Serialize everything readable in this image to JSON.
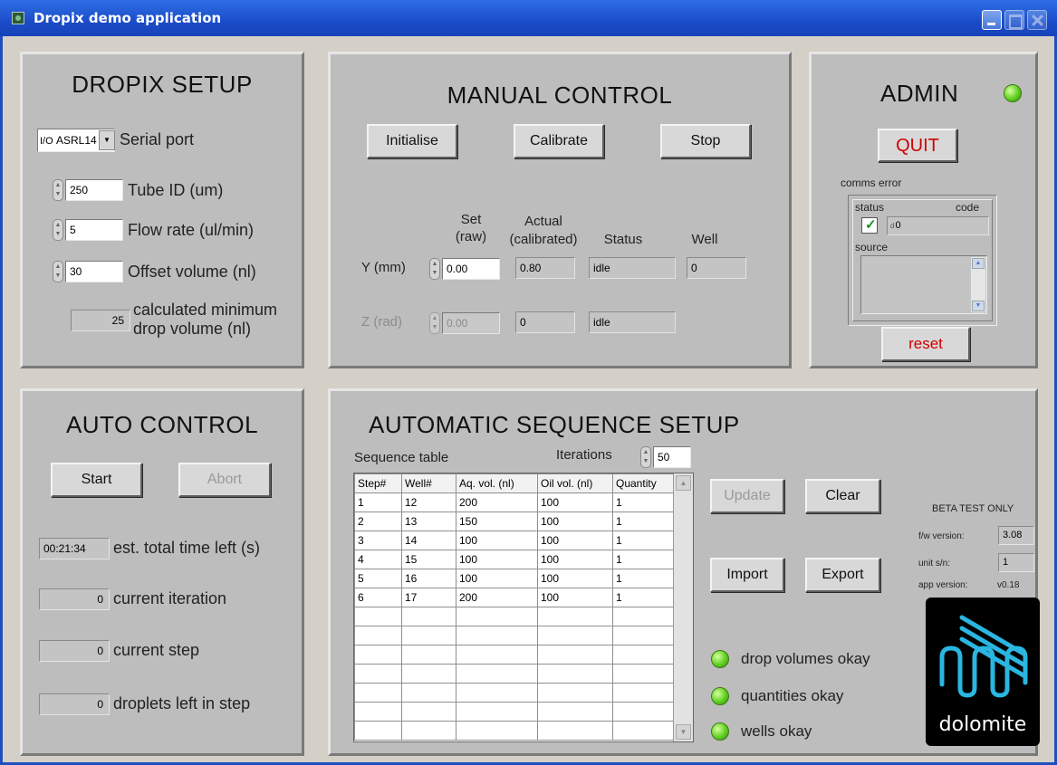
{
  "window": {
    "title": "Dropix demo application"
  },
  "setup": {
    "title": "DROPIX SETUP",
    "serial_value": "ASRL14",
    "serial_label": "Serial port",
    "tube_id_value": "250",
    "tube_id_label": "Tube ID (um)",
    "flow_value": "5",
    "flow_label": "Flow rate (ul/min)",
    "offset_value": "30",
    "offset_label": "Offset volume (nl)",
    "min_drop_value": "25",
    "min_drop_label_1": "calculated minimum",
    "min_drop_label_2": "drop volume (nl)"
  },
  "manual": {
    "title": "MANUAL CONTROL",
    "initialise": "Initialise",
    "calibrate": "Calibrate",
    "stop": "Stop",
    "hdr_set_1": "Set",
    "hdr_set_2": "(raw)",
    "hdr_actual_1": "Actual",
    "hdr_actual_2": "(calibrated)",
    "hdr_status": "Status",
    "hdr_well": "Well",
    "y_label": "Y (mm)",
    "y_set": "0.00",
    "y_actual": "0.80",
    "y_status": "idle",
    "y_well": "0",
    "z_label": "Z (rad)",
    "z_set": "0.00",
    "z_actual": "0",
    "z_status": "idle"
  },
  "admin": {
    "title": "ADMIN",
    "quit": "QUIT",
    "comms_error": "comms error",
    "status_label": "status",
    "code_label": "code",
    "code_value": "0",
    "source_label": "source",
    "reset": "reset",
    "led_color": "#5fcf1f"
  },
  "auto": {
    "title": "AUTO CONTROL",
    "start": "Start",
    "abort": "Abort",
    "time_value": "00:21:34",
    "time_label": "est. total time left (s)",
    "iter_value": "0",
    "iter_label": "current iteration",
    "step_value": "0",
    "step_label": "current step",
    "drops_value": "0",
    "drops_label": "droplets left in step"
  },
  "sequence": {
    "title": "AUTOMATIC SEQUENCE SETUP",
    "table_label": "Sequence table",
    "iterations_label": "Iterations",
    "iterations_value": "50",
    "columns": [
      "Step#",
      "Well#",
      "Aq. vol. (nl)",
      "Oil vol. (nl)",
      "Quantity"
    ],
    "rows": [
      [
        "1",
        "12",
        "200",
        "100",
        "1"
      ],
      [
        "2",
        "13",
        "150",
        "100",
        "1"
      ],
      [
        "3",
        "14",
        "100",
        "100",
        "1"
      ],
      [
        "4",
        "15",
        "100",
        "100",
        "1"
      ],
      [
        "5",
        "16",
        "100",
        "100",
        "1"
      ],
      [
        "6",
        "17",
        "200",
        "100",
        "1"
      ]
    ],
    "update": "Update",
    "clear": "Clear",
    "import": "Import",
    "export": "Export",
    "led_drop": "drop volumes okay",
    "led_qty": "quantities okay",
    "led_wells": "wells okay",
    "beta": "BETA TEST ONLY",
    "fw_label": "f/w version:",
    "fw_value": "3.08",
    "sn_label": "unit s/n:",
    "sn_value": "1",
    "app_label": "app version:",
    "app_value": "v0.18",
    "logo_text": "dolomite"
  }
}
